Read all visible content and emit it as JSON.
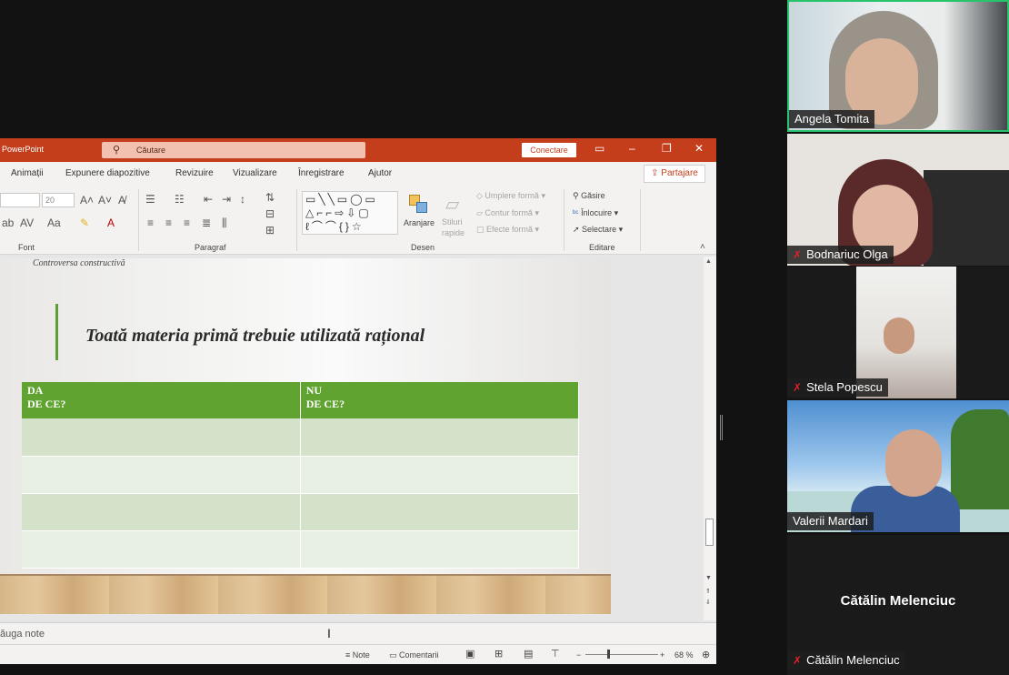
{
  "powerpoint": {
    "app_title": "PowerPoint",
    "search_placeholder": "Căutare",
    "connect_label": "Conectare",
    "share_label": "Partajare",
    "tabs": [
      "Animații",
      "Expunere diapozitive",
      "Revizuire",
      "Vizualizare",
      "Înregistrare",
      "Ajutor"
    ],
    "ribbon": {
      "font_size": "20",
      "group_font": "Font",
      "group_paragraph": "Paragraf",
      "group_drawing": "Desen",
      "group_editing": "Editare",
      "arrange": "Aranjare",
      "quick_styles": "Stiluri rapide",
      "shape_fill": "Umplere formă",
      "shape_outline": "Contur formă",
      "shape_effects": "Efecte formă",
      "find": "Găsire",
      "replace": "Înlocuire",
      "select": "Selectare"
    },
    "slide": {
      "caption": "Controversa constructivă",
      "title": "Toată materia primă trebuie utilizată rațional",
      "table": {
        "headers": [
          {
            "line1": "DA",
            "line2": "DE CE?"
          },
          {
            "line1": "NU",
            "line2": "DE CE?"
          }
        ],
        "rows": [
          [
            "",
            ""
          ],
          [
            "",
            ""
          ],
          [
            "",
            ""
          ],
          [
            "",
            ""
          ]
        ]
      }
    },
    "notes_placeholder": "ăuga note",
    "status": {
      "notes": "Note",
      "comments": "Comentarii",
      "zoom": "68 %"
    }
  },
  "participants": [
    {
      "name": "Angela Tomita",
      "muted": false,
      "active_speaker": true
    },
    {
      "name": "Bodnariuc Olga",
      "muted": true
    },
    {
      "name": "Stela Popescu",
      "muted": true
    },
    {
      "name": "Valerii Mardari",
      "muted": false
    },
    {
      "name": "Cătălin Melenciuc",
      "muted": true,
      "video_off": true
    }
  ],
  "colors": {
    "ppt_accent": "#c43e1c",
    "table_header": "#61a331",
    "active_speaker_border": "#27c46b",
    "muted_mic": "#e0202a"
  }
}
